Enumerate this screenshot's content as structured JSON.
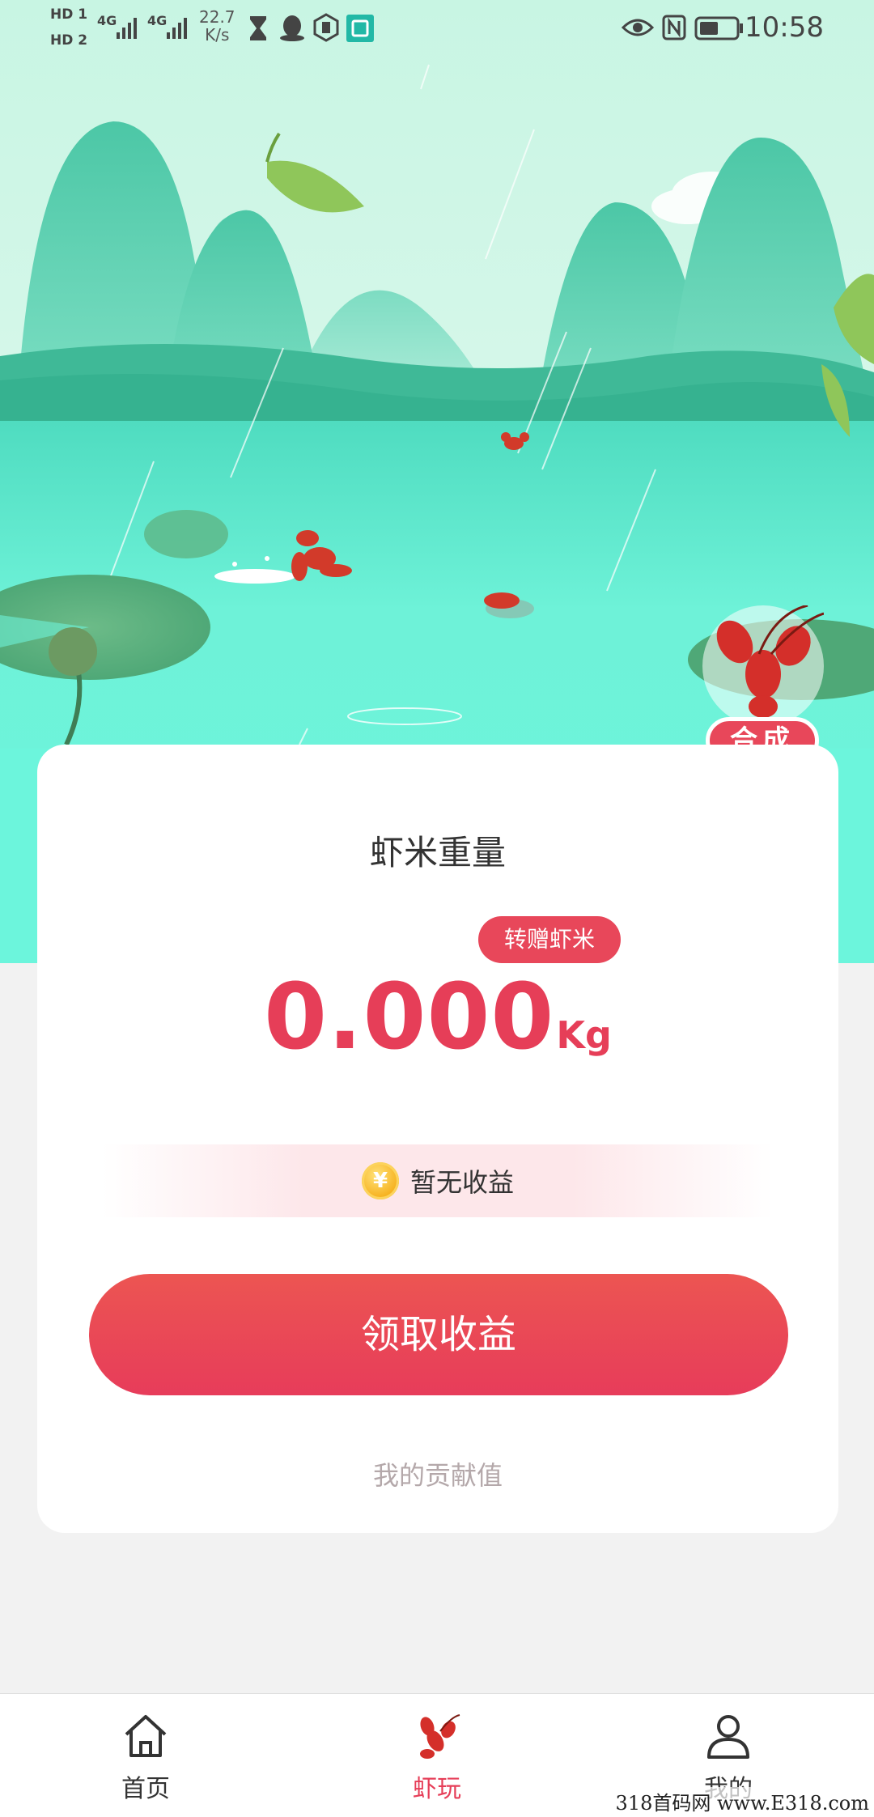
{
  "status_bar": {
    "sim1": "HD 1",
    "sim2": "HD 2",
    "net1": "4G",
    "net2": "4G",
    "speed_value": "22.7",
    "speed_unit": "K/s",
    "time": "10:58",
    "icons": [
      "hourglass-icon",
      "qq-icon",
      "shield-icon",
      "mi-icon",
      "eye-icon",
      "nfc-icon",
      "battery-icon"
    ]
  },
  "game": {
    "merge_label": "合成"
  },
  "card": {
    "title": "虾米重量",
    "gift_label": "转赠虾米",
    "weight": "0.000",
    "unit": "Kg",
    "earnings_text": "暂无收益",
    "coin_symbol": "¥",
    "claim_label": "领取收益",
    "contribution_label": "我的贡献值"
  },
  "nav": {
    "items": [
      {
        "label": "首页",
        "icon": "home-icon"
      },
      {
        "label": "虾玩",
        "icon": "crayfish-icon",
        "active": true
      },
      {
        "label": "我的",
        "icon": "user-icon"
      }
    ]
  },
  "watermark": "318首码网 www.E318.com",
  "colors": {
    "accent": "#e63e58",
    "button_gradient_top": "#ec5552",
    "button_gradient_bottom": "#e73c5a",
    "water": "#6ef2d8",
    "mountain": "#4fc9a8"
  }
}
